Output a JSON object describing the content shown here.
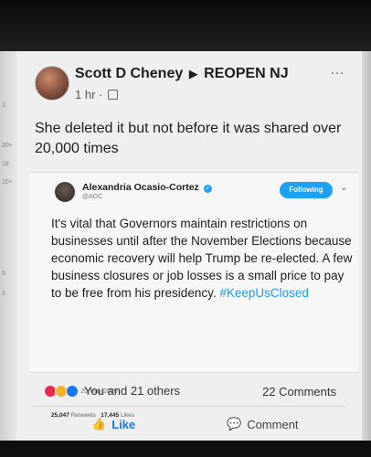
{
  "post": {
    "author": "Scott D Cheney",
    "group": "REOPEN NJ",
    "time": "1 hr ·",
    "more_icon": "…",
    "status_text": "She deleted it but not before it was shared over 20,000 times",
    "reactions_text": "You and 21 others",
    "comments_text": "22 Comments",
    "like_label": "Like",
    "comment_label": "Comment"
  },
  "tweet": {
    "name": "Alexandria Ocasio-Cortez",
    "handle": "@AOC",
    "follow_label": "Following",
    "text": "It's vital that Governors maintain restrictions on businesses until after the November Elections because economic recovery will help Trump be re-elected. A few business closures or job losses is a small price to pay to be free from his presidency.",
    "hashtag": "#KeepUsClosed",
    "timestamp": "1:09 PM · 20 May 2020",
    "retweets_value": "25,047",
    "retweets_label": "Retweets",
    "likes_value": "17,445",
    "likes_label": "Likes"
  },
  "left_ticks": [
    "3",
    "20+",
    "18",
    "20+",
    "5",
    "3"
  ],
  "colors": {
    "accent": "#1877f2",
    "twitter_blue": "#1da1f2",
    "text": "#1d1d1d"
  }
}
